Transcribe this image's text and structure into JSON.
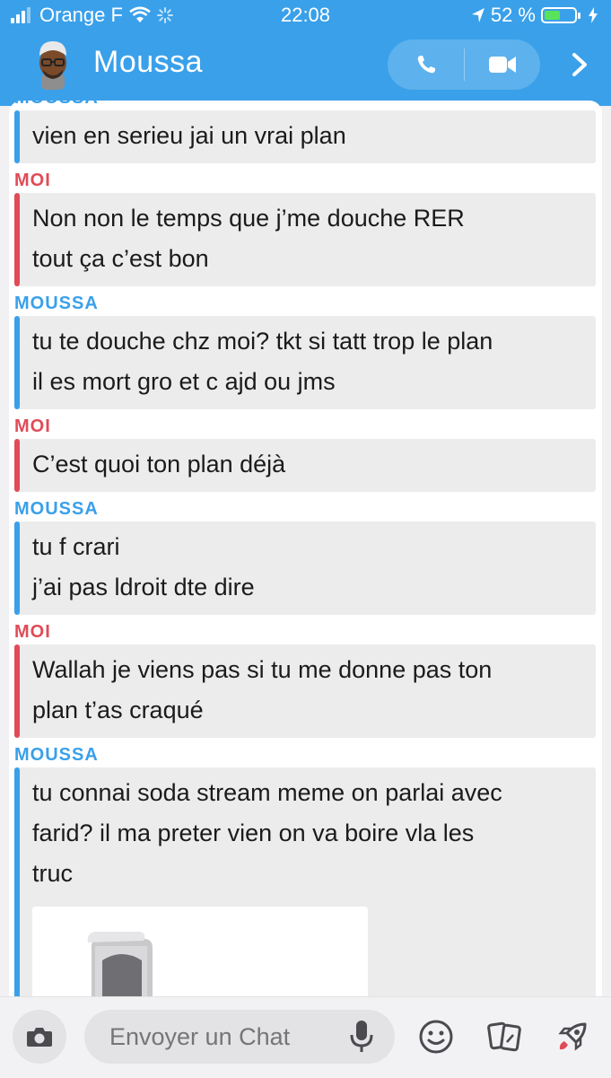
{
  "status_bar": {
    "carrier": "Orange F",
    "time": "22:08",
    "battery_text": "52 %",
    "battery_level": 0.52
  },
  "header": {
    "contact_name": "Moussa",
    "accent_color": "#3aa0ea",
    "icons": [
      "phone-icon",
      "video-camera-icon",
      "chevron-right-icon"
    ]
  },
  "messages": [
    {
      "sender": "MOUSSA",
      "side": "moussa",
      "lines": [
        "vien en serieu jai un vrai plan"
      ],
      "partial_top": true
    },
    {
      "sender": "MOI",
      "side": "moi",
      "lines": [
        "Non non le temps que j’me douche RER",
        "tout ça c’est bon"
      ]
    },
    {
      "sender": "MOUSSA",
      "side": "moussa",
      "lines": [
        "tu te douche chz moi? tkt si tatt trop le plan",
        "il es mort gro et c ajd ou jms"
      ]
    },
    {
      "sender": "MOI",
      "side": "moi",
      "lines": [
        "C’est quoi ton plan déjà"
      ]
    },
    {
      "sender": "MOUSSA",
      "side": "moussa",
      "lines": [
        "tu f crari",
        "j’ai pas ldroit dte dire"
      ]
    },
    {
      "sender": "MOI",
      "side": "moi",
      "lines": [
        "Wallah je viens pas si tu me donne pas ton",
        "plan t’as craqué"
      ]
    },
    {
      "sender": "MOUSSA",
      "side": "moussa",
      "lines": [
        "tu connai soda stream meme on parlai avec",
        "farid? il ma preter vien on va boire vla les",
        "truc"
      ],
      "has_image": true
    }
  ],
  "colors": {
    "moussa": "#3aa0ea",
    "moi": "#e04b57",
    "bubble": "#ececec"
  },
  "input_bar": {
    "placeholder": "Envoyer un Chat",
    "icons": [
      "camera-icon",
      "microphone-icon",
      "smiley-icon",
      "sticker-icon",
      "rocket-icon"
    ]
  }
}
